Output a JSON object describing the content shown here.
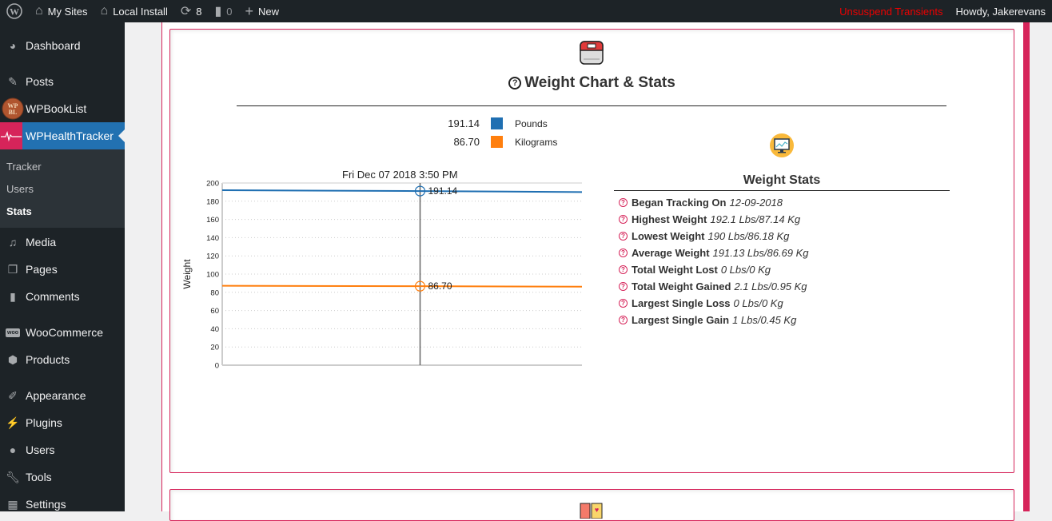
{
  "adminbar": {
    "my_sites": "My Sites",
    "site_name": "Local Install",
    "updates_count": "8",
    "comments_count": "0",
    "new_label": "New",
    "unsuspend": "Unsuspend Transients",
    "howdy": "Howdy, Jakerevans"
  },
  "sidebar": {
    "items": [
      {
        "label": "Dashboard",
        "icon": "dashboard-icon"
      },
      {
        "label": "Posts",
        "icon": "pin-icon"
      },
      {
        "label": "WPBookList",
        "icon": "wpbl-logo-icon"
      },
      {
        "label": "WPHealthTracker",
        "icon": "heartbeat-icon"
      },
      {
        "label": "Media",
        "icon": "media-icon"
      },
      {
        "label": "Pages",
        "icon": "pages-icon"
      },
      {
        "label": "Comments",
        "icon": "comment-icon"
      },
      {
        "label": "WooCommerce",
        "icon": "woo-icon"
      },
      {
        "label": "Products",
        "icon": "box-icon"
      },
      {
        "label": "Appearance",
        "icon": "brush-icon"
      },
      {
        "label": "Plugins",
        "icon": "plug-icon"
      },
      {
        "label": "Users",
        "icon": "user-icon"
      },
      {
        "label": "Tools",
        "icon": "wrench-icon"
      },
      {
        "label": "Settings",
        "icon": "sliders-icon"
      }
    ],
    "submenu": [
      "Tracker",
      "Users",
      "Stats"
    ],
    "active_submenu": "Stats"
  },
  "panel": {
    "title": "Weight Chart & Stats",
    "chart_date": "Fri Dec 07 2018 3:50 PM",
    "legend": [
      {
        "value": "191.14",
        "name": "Pounds",
        "color": "#1f6fb2"
      },
      {
        "value": "86.70",
        "name": "Kilograms",
        "color": "#ff7f0e"
      }
    ]
  },
  "chart_data": {
    "type": "line",
    "title": "",
    "xlabel": "",
    "ylabel": "Weight",
    "ylim": [
      0,
      200
    ],
    "yticks": [
      "0",
      "20",
      "40",
      "60",
      "80",
      "100",
      "120",
      "140",
      "160",
      "180",
      "200"
    ],
    "grid": true,
    "cursor_label": "Fri Dec 07 2018 3:50 PM",
    "cursor_fraction": 0.55,
    "series": [
      {
        "name": "Pounds",
        "color": "#1f6fb2",
        "x": [
          0,
          0.55,
          1
        ],
        "values": [
          192.1,
          191.14,
          190
        ],
        "cursor_value": "191.14"
      },
      {
        "name": "Kilograms",
        "color": "#ff7f0e",
        "x": [
          0,
          0.55,
          1
        ],
        "values": [
          87.14,
          86.7,
          86.18
        ],
        "cursor_value": "86.70"
      }
    ]
  },
  "stats": {
    "title": "Weight Stats",
    "rows": [
      {
        "label": "Began Tracking On",
        "value": "12-09-2018"
      },
      {
        "label": "Highest Weight",
        "value": "192.1 Lbs/87.14 Kg"
      },
      {
        "label": "Lowest Weight",
        "value": "190 Lbs/86.18 Kg"
      },
      {
        "label": "Average Weight",
        "value": "191.13 Lbs/86.69 Kg"
      },
      {
        "label": "Total Weight Lost",
        "value": "0 Lbs/0 Kg"
      },
      {
        "label": "Total Weight Gained",
        "value": "2.1 Lbs/0.95 Kg"
      },
      {
        "label": "Largest Single Loss",
        "value": "0 Lbs/0 Kg"
      },
      {
        "label": "Largest Single Gain",
        "value": "1 Lbs/0.45 Kg"
      }
    ]
  }
}
